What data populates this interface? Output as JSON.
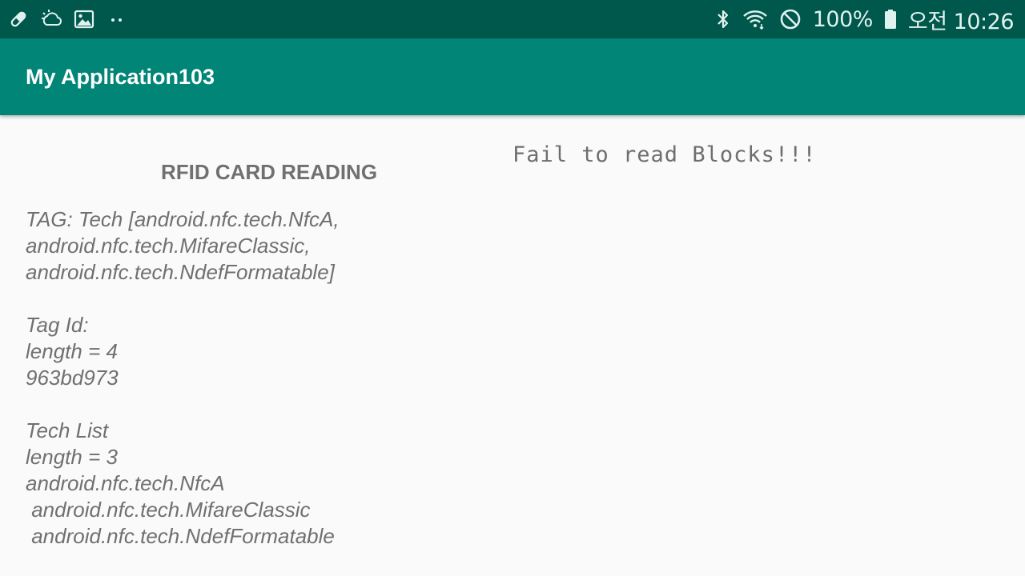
{
  "status_bar": {
    "icons_left": [
      "pen-icon",
      "cloud-sync-icon",
      "image-icon",
      "more-dots-icon"
    ],
    "icons_right": [
      "bluetooth-icon",
      "wifi-icon",
      "do-not-disturb-icon",
      "battery-icon"
    ],
    "battery": "100%",
    "time": "오전 10:26"
  },
  "app_bar": {
    "title": "My Application103"
  },
  "main": {
    "heading": "RFID CARD READING",
    "status_message": "Fail to read Blocks!!!",
    "tag_info": "TAG: Tech [android.nfc.tech.NfcA,\nandroid.nfc.tech.MifareClassic,\nandroid.nfc.tech.NdefFormatable]\n\nTag Id:\nlength = 4\n963bd973\n\nTech List\nlength = 3\nandroid.nfc.tech.NfcA\n android.nfc.tech.MifareClassic\n android.nfc.tech.NdefFormatable"
  },
  "colors": {
    "status_bar": "#00574b",
    "app_bar": "#008577",
    "background": "#fafafa",
    "text": "#707070"
  }
}
